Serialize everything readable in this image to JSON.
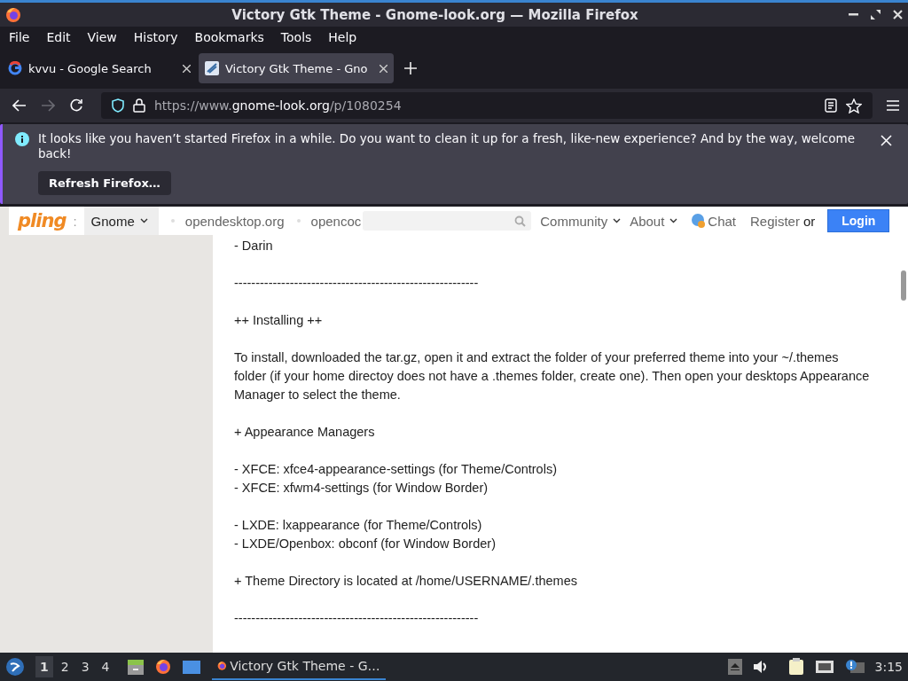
{
  "window": {
    "title": "Victory Gtk Theme - Gnome-look.org — Mozilla Firefox"
  },
  "menu": [
    "File",
    "Edit",
    "View",
    "History",
    "Bookmarks",
    "Tools",
    "Help"
  ],
  "tabs": [
    {
      "title": "kvvu - Google Search",
      "selected": false
    },
    {
      "title": "Victory Gtk Theme - Gno",
      "selected": true
    }
  ],
  "toolbar": {
    "forward_disabled": true,
    "url_prefix": "https://www.",
    "url_domain": "gnome-look.org",
    "url_path": "/p/1080254"
  },
  "notification": {
    "message": "It looks like you haven’t started Firefox in a while. Do you want to clean it up for a fresh, like-new experience? And by the way, welcome back!",
    "button": "Refresh Firefox…"
  },
  "site_nav": {
    "logo": "pling",
    "separator": ":",
    "category": "Gnome",
    "links": [
      "opendesktop.org",
      "opencoc"
    ],
    "menus": [
      "Community",
      "About"
    ],
    "chat": "Chat",
    "register": "Register",
    "or": "or",
    "login": "Login"
  },
  "content": [
    [
      "- Darin"
    ],
    [
      "---------------------------------------------------------"
    ],
    [
      "++ Installing ++"
    ],
    [
      "To install, downloaded the tar.gz, open it and extract the folder of your preferred theme into your ~/.themes folder (if your home directoy does not have a .themes folder, create one). Then open your desktops Appearance Manager to select the theme."
    ],
    [
      "+ Appearance Managers"
    ],
    [
      "- XFCE: xfce4-appearance-settings (for Theme/Controls)",
      "- XFCE: xfwm4-settings (for Window Border)"
    ],
    [
      "- LXDE: lxappearance (for Theme/Controls)",
      "- LXDE/Openbox: obconf (for Window Border)"
    ],
    [
      "+ Theme Directory is located at /home/USERNAME/.themes"
    ],
    [
      "---------------------------------------------------------"
    ]
  ],
  "taskbar": {
    "workspaces": [
      {
        "label": "1",
        "selected": true
      },
      {
        "label": "2",
        "selected": false
      },
      {
        "label": "3",
        "selected": false
      },
      {
        "label": "4",
        "selected": false
      }
    ],
    "task": "Victory Gtk Theme - G…",
    "clock": "3:15"
  }
}
